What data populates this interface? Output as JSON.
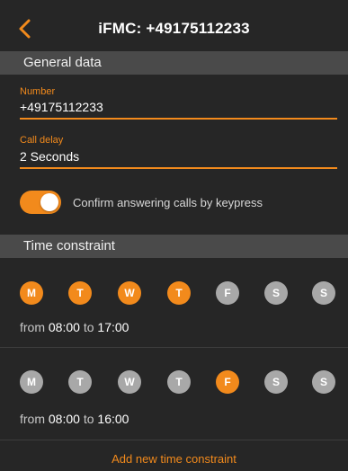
{
  "header": {
    "title": "iFMC: +49175112233"
  },
  "general": {
    "section_title": "General data",
    "number_label": "Number",
    "number_value": "+49175112233",
    "delay_label": "Call delay",
    "delay_value": "2 Seconds",
    "confirm_label": "Confirm answering calls by keypress",
    "confirm_enabled": true
  },
  "time": {
    "section_title": "Time constraint",
    "from_word": "from",
    "to_word": "to",
    "constraints": [
      {
        "days": [
          {
            "label": "M",
            "active": true
          },
          {
            "label": "T",
            "active": true
          },
          {
            "label": "W",
            "active": true
          },
          {
            "label": "T",
            "active": true
          },
          {
            "label": "F",
            "active": false
          },
          {
            "label": "S",
            "active": false
          },
          {
            "label": "S",
            "active": false
          }
        ],
        "from": "08:00",
        "to": "17:00"
      },
      {
        "days": [
          {
            "label": "M",
            "active": false
          },
          {
            "label": "T",
            "active": false
          },
          {
            "label": "W",
            "active": false
          },
          {
            "label": "T",
            "active": false
          },
          {
            "label": "F",
            "active": true
          },
          {
            "label": "S",
            "active": false
          },
          {
            "label": "S",
            "active": false
          }
        ],
        "from": "08:00",
        "to": "16:00"
      }
    ],
    "add_label": "Add new time constraint"
  },
  "colors": {
    "accent": "#f28a1c",
    "inactive_day": "#a8a8a8",
    "section_bg": "#4a4a4a",
    "background": "#262626"
  },
  "icons": {
    "back": "chevron-left-icon"
  }
}
